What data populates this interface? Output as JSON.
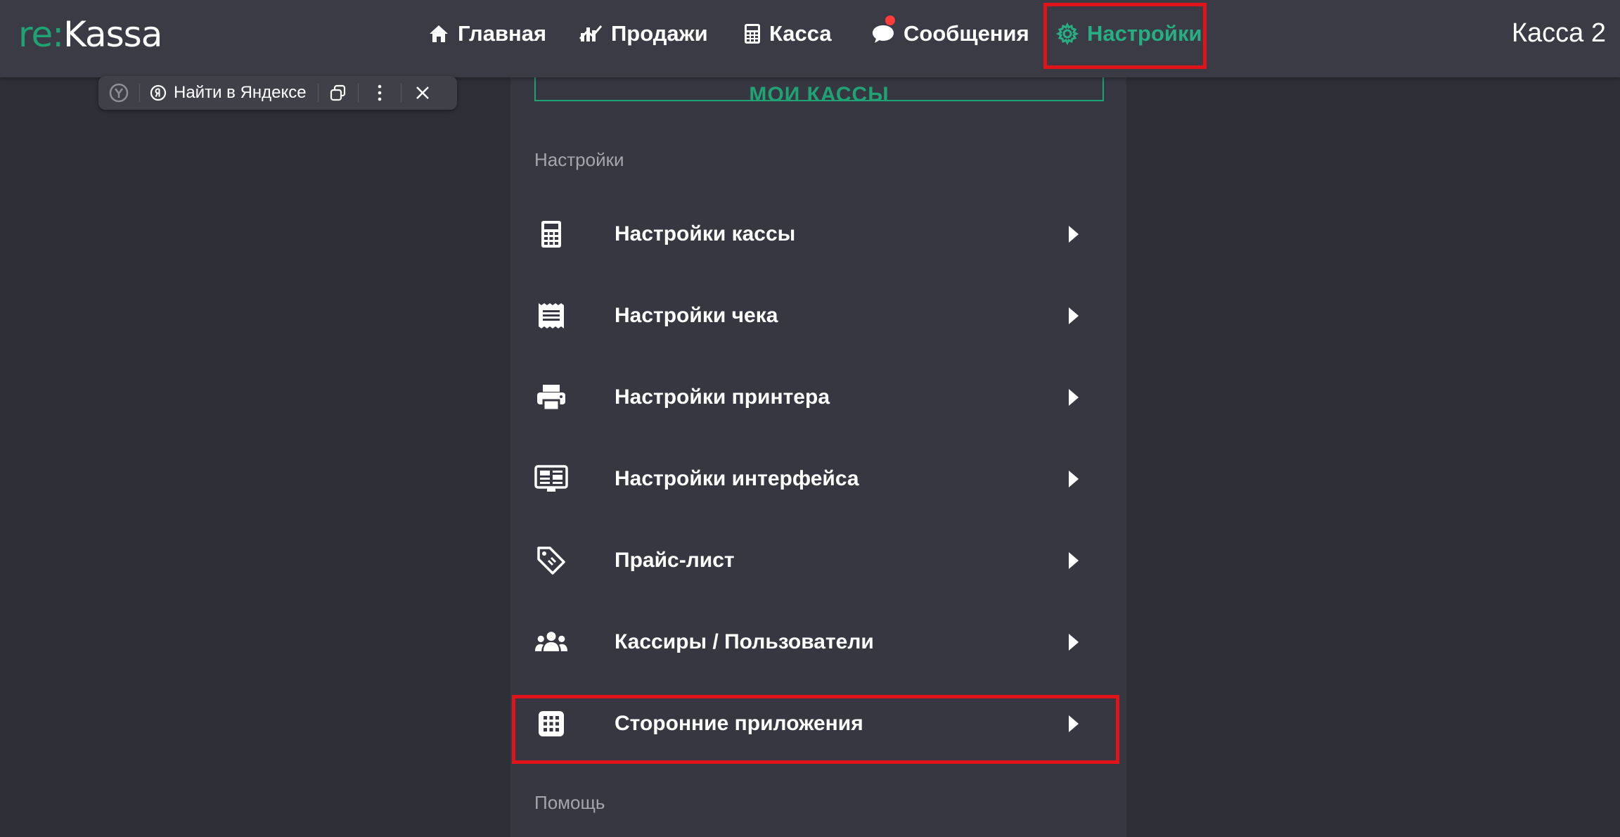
{
  "logo": {
    "prefix": "re:",
    "name": "Kassa"
  },
  "nav": {
    "items": [
      {
        "label": "Главная",
        "icon": "home-icon"
      },
      {
        "label": "Продажи",
        "icon": "sales-chart-icon"
      },
      {
        "label": "Касса",
        "icon": "calculator-icon"
      },
      {
        "label": "Сообщения",
        "icon": "chat-bubble-icon",
        "badge": true
      },
      {
        "label": "Настройки",
        "icon": "gear-icon",
        "active": true
      }
    ]
  },
  "register_name": "Касса 2",
  "yandex_bar": {
    "search_label": "Найти в Яндексе"
  },
  "my_registers_button": "МОИ КАССЫ",
  "settings_section": {
    "title": "Настройки",
    "items": [
      {
        "label": "Настройки кассы",
        "icon": "calculator-icon"
      },
      {
        "label": "Настройки чека",
        "icon": "receipt-icon"
      },
      {
        "label": "Настройки принтера",
        "icon": "printer-icon"
      },
      {
        "label": "Настройки интерфейса",
        "icon": "interface-icon"
      },
      {
        "label": "Прайс-лист",
        "icon": "price-tag-icon"
      },
      {
        "label": "Кассиры / Пользователи",
        "icon": "users-icon"
      },
      {
        "label": "Сторонние приложения",
        "icon": "apps-grid-icon"
      }
    ]
  },
  "help_section": {
    "title": "Помощь"
  },
  "colors": {
    "accent": "#27ae82",
    "highlight": "#e0131a",
    "background": "#2f2f38",
    "panel": "#373741"
  }
}
